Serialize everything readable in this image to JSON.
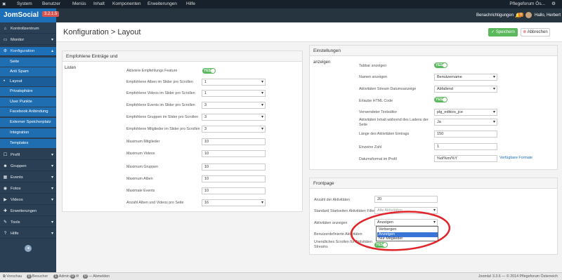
{
  "topbar": {
    "menus": [
      "System",
      "Benutzer",
      "Menüs",
      "Inhalt",
      "Komponenten",
      "Erweiterungen",
      "Hilfe"
    ],
    "site_name": "Pflegeforum Ös...",
    "gear": "⚙"
  },
  "brand": {
    "logo": "JomSocial",
    "version": "3.2.1.5"
  },
  "header_right": {
    "notifications": "Benachrichtigungen",
    "count": "0",
    "greeting": "Hallo, Herbert"
  },
  "page": {
    "title": "Konfiguration > Layout",
    "save": "Speichern",
    "cancel": "Abbrechen"
  },
  "sidebar": {
    "items": [
      {
        "label": "Kontrollzentrum",
        "icon": "home-icon",
        "glyph": "⌂"
      },
      {
        "label": "Monitor",
        "icon": "monitor-icon",
        "glyph": "▭"
      },
      {
        "label": "Konfiguration",
        "icon": "gears-icon",
        "glyph": "⚙"
      },
      {
        "label": "Seite"
      },
      {
        "label": "Anti Spam"
      },
      {
        "label": "Layout"
      },
      {
        "label": "Privatsphäre"
      },
      {
        "label": "User Punkte"
      },
      {
        "label": "Facebook Anbindung"
      },
      {
        "label": "Externer Speicherplatz"
      },
      {
        "label": "Integration"
      },
      {
        "label": "Templates"
      },
      {
        "label": "Profil",
        "icon": "profile-icon",
        "glyph": "☐"
      },
      {
        "label": "Gruppen",
        "icon": "groups-icon",
        "glyph": "☻"
      },
      {
        "label": "Events",
        "icon": "calendar-icon",
        "glyph": "▦"
      },
      {
        "label": "Fotos",
        "icon": "camera-icon",
        "glyph": "◉"
      },
      {
        "label": "Videos",
        "icon": "video-icon",
        "glyph": "▶"
      },
      {
        "label": "Erweiterungen",
        "icon": "puzzle-icon",
        "glyph": "✚"
      },
      {
        "label": "Tools",
        "icon": "wrench-icon",
        "glyph": "✎"
      },
      {
        "label": "Hilfe",
        "icon": "help-icon",
        "glyph": "?"
      }
    ],
    "collapse": "◂"
  },
  "left_panel": {
    "title": "Empfohlene Einträge und",
    "section": "Listen",
    "toggle_label": "YES",
    "rows": [
      {
        "label": "Aktiviere Empfehlungs Feature",
        "value": ""
      },
      {
        "label": "Empfohlene Alben im Slider pro Scrollen",
        "value": "1"
      },
      {
        "label": "Empfohlene Videos im Slider pro Scrollen",
        "value": "1"
      },
      {
        "label": "Empfohlene Events im Slider pro Scrollen",
        "value": "3"
      },
      {
        "label": "Empfohlene Gruppen im Slider pro Scrollen",
        "value": "3"
      },
      {
        "label": "Empfohlene Mitglieder im Slider pro Scrollen",
        "value": "3"
      },
      {
        "label": "Maximum Mitglieder",
        "value": "10"
      },
      {
        "label": "Maximum Videos",
        "value": "10"
      },
      {
        "label": "Maximum Gruppen",
        "value": "10"
      },
      {
        "label": "Maximum Alben",
        "value": "10"
      },
      {
        "label": "Maximale Events",
        "value": "10"
      },
      {
        "label": "Anzahl Alben und Videos pro Seite",
        "value": "16"
      }
    ]
  },
  "settings_panel": {
    "title": "Einstellungen",
    "section": "anzeigen",
    "toggle_label": "YES",
    "rows": [
      {
        "label": "Tabbar anzeigen",
        "value": ""
      },
      {
        "label": "Namen anzeigen",
        "value": "Benutzername"
      },
      {
        "label": "Aktivitäten Stream Datumsanzeige",
        "value": "Abfallend"
      },
      {
        "label": "Erlaube HTML Code",
        "value": ""
      },
      {
        "label": "Verwendeter Texteditor",
        "value": "plg_editors_jce"
      },
      {
        "label": "Aktivitäten Inhalt während des Ladens der",
        "label2": "Seite",
        "value": "Ja"
      },
      {
        "label": "Länge des Aktivitäten Eintrags",
        "value": "150"
      },
      {
        "label": "Einzeine Zahl",
        "value": "1"
      },
      {
        "label": "Datumsformat im Profil",
        "value": "%d/%m/%Y"
      }
    ],
    "formats_link": "Verfügbare Formate"
  },
  "frontpage_panel": {
    "title": "Frontpage",
    "rows": [
      {
        "label": "Anzahl der Aktivitäten",
        "value": "20"
      },
      {
        "label": "Standard Startseiten Aktivitäten Filter",
        "value": "Alle Aktivitäten"
      },
      {
        "label": "Aktivitäten anzeigen",
        "value": "Anzeigen"
      },
      {
        "label": "Benutzerdefinierte Aktivitäten",
        "value": ""
      },
      {
        "label": "Unendliches Scrollen für Aktivitäten",
        "label2": "Streams",
        "value": ""
      }
    ],
    "dropdown_options": [
      "Verbergen",
      "Anzeigen",
      "Nur Mitglieder"
    ],
    "dropdown_selected": "Anzeigen",
    "toggle_label": "YES"
  },
  "footer": {
    "preview": "Vorschau",
    "visitors_count": "0",
    "visitors": "Besucher",
    "admin_count": "1",
    "admin": "Admin",
    "mail_count": "0",
    "logout_count": "0",
    "logout": "Abmelden",
    "right": "Joomla! 3.3.6 — © 2014 Pflegeforum Österreich"
  },
  "colors": {
    "accent": "#1d6fb8",
    "sidebar": "#2a3f54",
    "save": "#5cb85c",
    "annotation": "#e0242a"
  }
}
